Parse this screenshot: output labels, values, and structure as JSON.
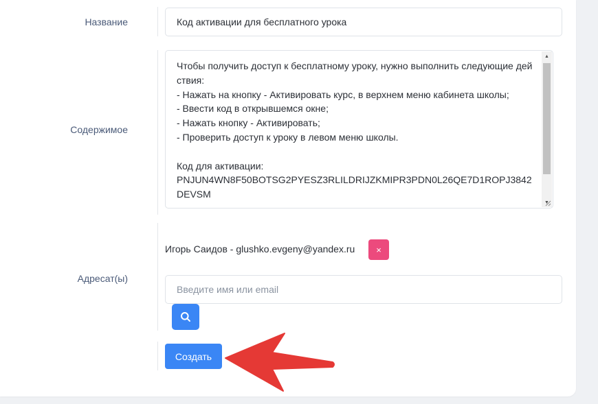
{
  "colors": {
    "primary": "#3a86f5",
    "danger": "#ec4a7d",
    "arrow": "#e53935",
    "label": "#4a5a78"
  },
  "form": {
    "title_label": "Название",
    "title_value": "Код активации для бесплатного урока",
    "content_label": "Содержимое",
    "content_value": "Чтобы получить доступ к бесплатному уроку, нужно выполнить следующие действия:\n- Нажать на кнопку - Активировать курс, в верхнем меню кабинета школы;\n- Ввести код в открывшемся окне;\n- Нажать кнопку - Активировать;\n- Проверить доступ к уроку в левом меню школы.\n\nКод для активации:\nPNJUN4WN8F50BOTSG2PYESZ3RLILDRIJZKMIPR3PDN0L26QE7D1ROPJ3842DEVSM",
    "recipients_label": "Адресат(ы)",
    "recipients": [
      {
        "text": "Игорь Саидов - glushko.evgeny@yandex.ru",
        "remove_icon": "×"
      }
    ],
    "recipient_search_placeholder": "Введите имя или email",
    "search_icon": "search-icon",
    "submit_label": "Создать"
  }
}
